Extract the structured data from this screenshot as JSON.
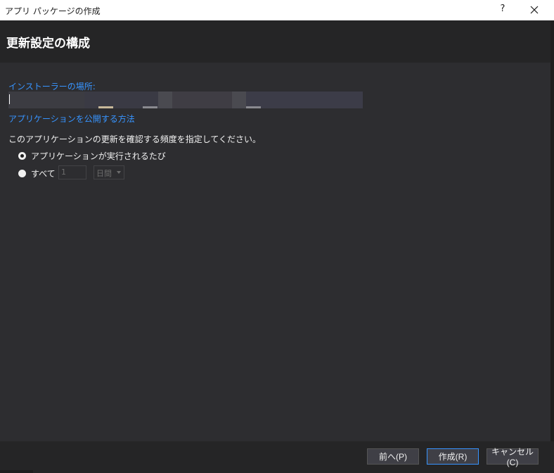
{
  "window": {
    "title": "アプリ パッケージの作成",
    "help_label": "?"
  },
  "header": {
    "title": "更新設定の構成"
  },
  "installer": {
    "label": "インストーラーの場所:",
    "value": ""
  },
  "publish_link": "アプリケーションを公開する方法",
  "update_check": {
    "description": "このアプリケーションの更新を確認する頻度を指定してください。",
    "option_every_run": "アプリケーションが実行されるたび",
    "option_every": "すべて",
    "interval_value": "1",
    "interval_unit": "日間",
    "selected": "every_run"
  },
  "footer": {
    "back_label": "前へ(P)",
    "create_label": "作成(R)",
    "cancel_label": "キャンセル(C)"
  },
  "colors": {
    "accent": "#3794ff",
    "background": "#2d2d30",
    "header_bg": "#252526"
  }
}
